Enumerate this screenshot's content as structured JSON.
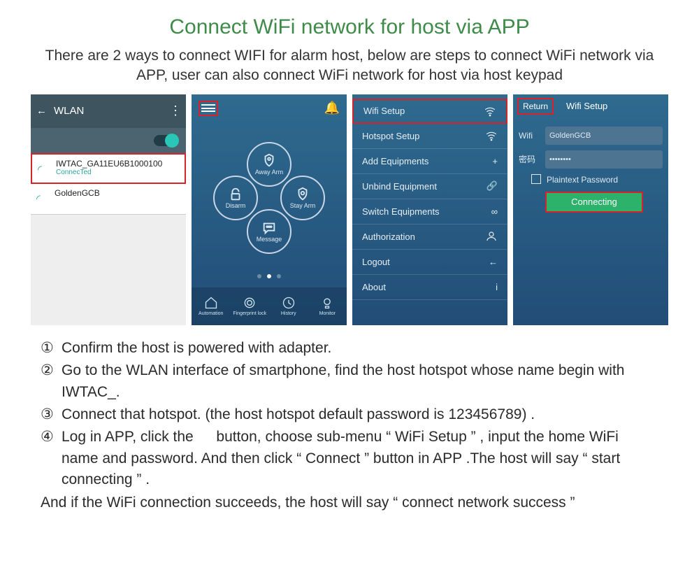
{
  "title": "Connect WiFi network for host via APP",
  "description": "There are 2 ways to connect WIFI for alarm host, below are steps to connect WiFi network via APP, user can also connect WiFi network for host via host keypad",
  "screen1": {
    "title": "WLAN",
    "wifi_selected_name": "IWTAC_GA11EU6B1000100",
    "wifi_selected_status": "ConnecTed",
    "wifi_other": "GoldenGCB"
  },
  "screen2": {
    "away": "Away Arm",
    "disarm": "Disarm",
    "stay": "Stay Arm",
    "message": "Message",
    "nav": {
      "automation": "Automation",
      "fp": "Fingerprint lock",
      "history": "History",
      "monitor": "Monitor"
    }
  },
  "screen3": {
    "items": [
      "Wifi Setup",
      "Hotspot Setup",
      "Add Equipments",
      "Unbind Equipment",
      "Switch Equipments",
      "Authorization",
      "Logout",
      "About"
    ]
  },
  "screen4": {
    "return": "Return",
    "title": "Wifi Setup",
    "wifi_label": "Wifi",
    "wifi_value": "GoldenGCB",
    "pw_label": "密码",
    "pw_value": "••••••••",
    "plaintext": "Plaintext Password",
    "connect": "Connecting"
  },
  "steps": {
    "s1": "Confirm the host is powered with adapter.",
    "s2": "Go to the WLAN interface of smartphone, find the host hotspot whose name begin with IWTAC_.",
    "s3": "Connect that hotspot. (the host hotspot default password is 123456789) .",
    "s4": "Log in APP, click the   button, choose sub-menu “ WiFi Setup ” , input the home WiFi name and password. And then click “ Connect ” button in APP .The host will say “ start connecting ” .",
    "footer": "And if the WiFi connection succeeds, the host will say “ connect network success ”"
  },
  "nums": {
    "n1": "①",
    "n2": "②",
    "n3": "③",
    "n4": "④"
  }
}
